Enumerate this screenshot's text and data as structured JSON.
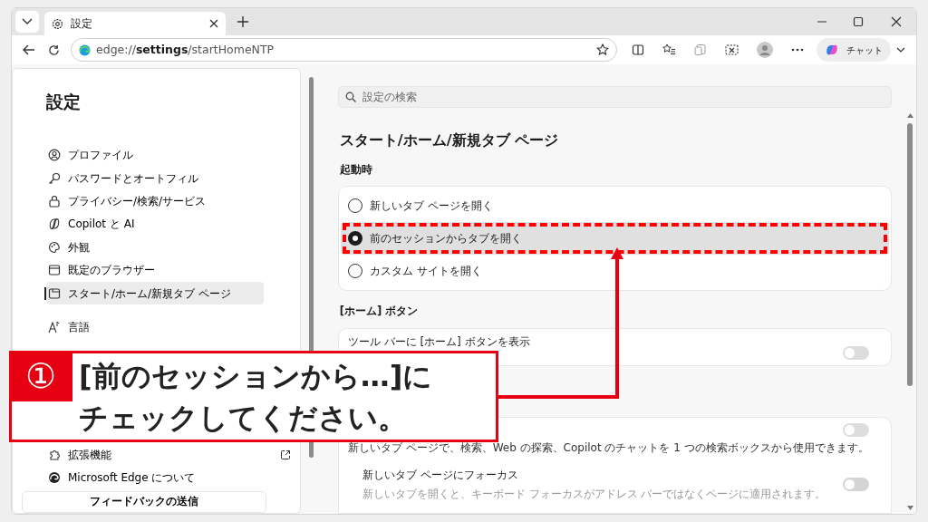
{
  "browser": {
    "tab_title": "設定",
    "address": "edge://**settings**/startHomeNTP",
    "copilot_button": "チャット"
  },
  "sidebar": {
    "title": "設定",
    "items": [
      {
        "label": "プロファイル",
        "selected": false
      },
      {
        "label": "パスワードとオートフィル",
        "selected": false
      },
      {
        "label": "プライバシー/検索/サービス",
        "selected": false
      },
      {
        "label": "Copilot と AI",
        "selected": false
      },
      {
        "label": "外観",
        "selected": false
      },
      {
        "label": "既定のブラウザー",
        "selected": false
      },
      {
        "label": "スタート/ホーム/新規タブ ページ",
        "selected": true
      }
    ],
    "items_2": [
      {
        "label": "言語",
        "selected": false,
        "external": false
      }
    ],
    "items_3": [
      {
        "label": "拡張機能",
        "selected": false,
        "external": true
      },
      {
        "label": "Microsoft Edge について",
        "selected": false,
        "external": false
      }
    ],
    "feedback_button": "フィードバックの送信"
  },
  "main": {
    "search_placeholder": "設定の検索",
    "page_title": "スタート/ホーム/新規タブ ページ",
    "startup": {
      "heading": "起動時",
      "options": [
        {
          "label": "新しいタブ ページを開く",
          "selected": false
        },
        {
          "label": "前のセッションからタブを開く",
          "selected": true
        },
        {
          "label": "カスタム サイトを開く",
          "selected": false
        }
      ]
    },
    "home_button": {
      "heading": "[ホーム] ボタン",
      "setting": {
        "title": "ツール バーに [ホーム] ボタンを表示",
        "on": false
      }
    },
    "new_tab": {
      "settings": [
        {
          "description": "新しいタブ ページで、検索、Web の探索、Copilot のチャットを 1 つの検索ボックスから使用できます。",
          "on": false,
          "disabled": false
        },
        {
          "title": "新しいタブ ページにフォーカス",
          "description": "新しいタブを開くと、キーボード フォーカスがアドレス バーではなくページに適用されます。",
          "on": false,
          "disabled": true
        }
      ]
    }
  },
  "callout": {
    "number": "①",
    "lines": [
      "[前のセッションから…]に",
      "チェックしてください。"
    ]
  }
}
